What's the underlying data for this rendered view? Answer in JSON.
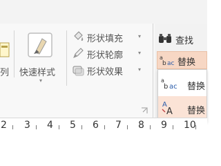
{
  "ribbon": {
    "layout_label_partial": "列",
    "quick_styles_label": "快速样式",
    "shape_fill_label": "形状填充",
    "shape_outline_label": "形状轮廓",
    "shape_effects_label": "形状效果",
    "find_label": "查找",
    "replace_label": "替换"
  },
  "replace_menu": {
    "items": [
      {
        "label": "替换"
      },
      {
        "label": "替换"
      }
    ]
  },
  "ruler": {
    "numbers": [
      "2",
      "3",
      "4",
      "5",
      "6",
      "7",
      "8",
      "9",
      "10"
    ]
  },
  "colors": {
    "highlight": "#f7d7c4",
    "highlight_border": "#eac0a6"
  }
}
